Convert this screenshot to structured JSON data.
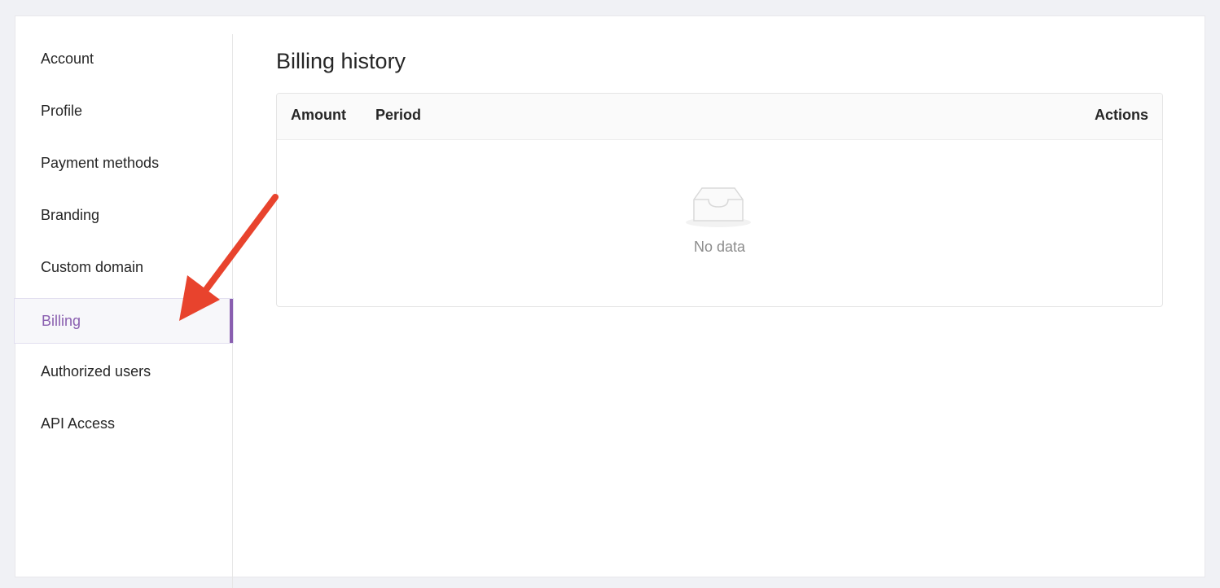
{
  "sidebar": {
    "items": [
      {
        "label": "Account"
      },
      {
        "label": "Profile"
      },
      {
        "label": "Payment methods"
      },
      {
        "label": "Branding"
      },
      {
        "label": "Custom domain"
      },
      {
        "label": "Billing",
        "active": true
      },
      {
        "label": "Authorized users"
      },
      {
        "label": "API Access"
      }
    ]
  },
  "main": {
    "title": "Billing history",
    "table": {
      "columns": [
        "Amount",
        "Period",
        "Actions"
      ],
      "rows": [],
      "empty_text": "No data"
    }
  },
  "colors": {
    "accent": "#8a5fb0",
    "annotation_arrow": "#e8432d",
    "page_background": "#f0f1f5"
  },
  "icons": {
    "empty": "inbox-icon",
    "annotation": "arrow-annotation"
  }
}
